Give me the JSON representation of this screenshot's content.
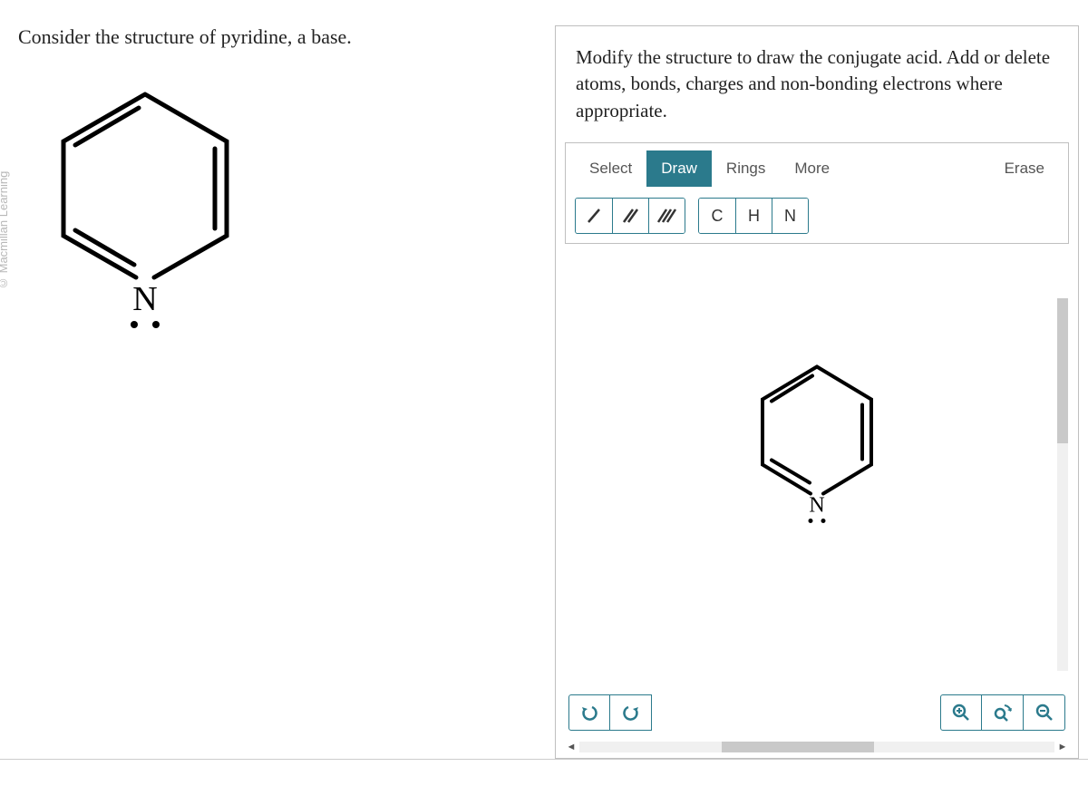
{
  "watermark": "© Macmillan Learning",
  "prompt": "Consider the structure of pyridine, a base.",
  "left_structure": {
    "atom_label": "N"
  },
  "editor": {
    "instruction": "Modify the structure to draw the conjugate acid. Add or delete atoms, bonds, charges and non-bonding electrons where appropriate.",
    "tabs": {
      "select": "Select",
      "draw": "Draw",
      "rings": "Rings",
      "more": "More",
      "erase": "Erase"
    },
    "bond_tools": {
      "single": "/",
      "double": "//",
      "triple": "///"
    },
    "atom_tools": {
      "c": "C",
      "h": "H",
      "n": "N"
    },
    "canvas_structure": {
      "atom_label": "N"
    },
    "controls": {
      "undo": "↶",
      "redo": "↷",
      "zoom_in": "⊕",
      "zoom_reset": "⟲",
      "zoom_out": "⊖"
    }
  }
}
